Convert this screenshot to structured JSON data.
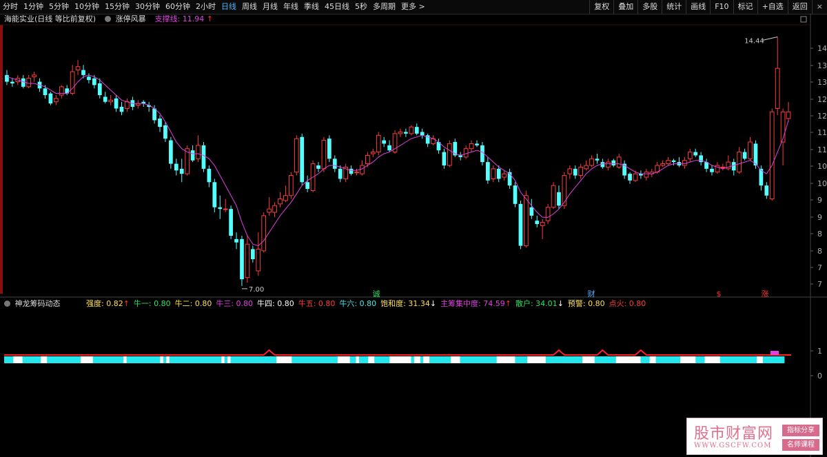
{
  "toolbar": {
    "periods": [
      "分时",
      "1分钟",
      "5分钟",
      "10分钟",
      "15分钟",
      "30分钟",
      "60分钟",
      "2小时",
      "日线",
      "周线",
      "月线",
      "年线",
      "季线",
      "45日线",
      "5秒",
      "多周期",
      "更多 >"
    ],
    "active_period": "日线",
    "actions": [
      "复权",
      "叠加",
      "多股",
      "统计",
      "画线",
      "F10",
      "标记",
      "+自选",
      "返回"
    ],
    "close_label": "×"
  },
  "main_info": {
    "stock": "海能实业(日线 等比前复权)",
    "indicator": "涨停风暴",
    "support_label": "支撑线: 11.94",
    "support_arrow": "↑"
  },
  "right_axis": {
    "price_labels": [
      "14",
      "13",
      "13",
      "12",
      "12",
      "11",
      "11",
      "10",
      "10",
      "9",
      "9",
      "8",
      "8",
      "7",
      "7"
    ],
    "sub_labels": [
      "1",
      "0"
    ]
  },
  "annotations": {
    "high_label": "14.44",
    "low_label": "7.00"
  },
  "markers": [
    "诚",
    "财",
    "$",
    "涨"
  ],
  "sub_chart": {
    "name": "神龙筹码动态",
    "items": [
      {
        "text": "强度: 0.82",
        "arrow": "↑",
        "color": "#ffe24a",
        "arrow_color": "#ff3030"
      },
      {
        "text": "牛一: 0.80",
        "arrow": "",
        "color": "#30e060",
        "arrow_color": ""
      },
      {
        "text": "牛二: 0.80",
        "arrow": "",
        "color": "#ffe24a",
        "arrow_color": ""
      },
      {
        "text": "牛三: 0.80",
        "arrow": "",
        "color": "#e040e0",
        "arrow_color": ""
      },
      {
        "text": "牛四: 0.80",
        "arrow": "",
        "color": "#ffffff",
        "arrow_color": ""
      },
      {
        "text": "牛五: 0.80",
        "arrow": "",
        "color": "#ff3b3b",
        "arrow_color": ""
      },
      {
        "text": "牛六: 0.80",
        "arrow": "",
        "color": "#4fe8e8",
        "arrow_color": ""
      },
      {
        "text": "饱和度: 31.34",
        "arrow": "↓",
        "color": "#ffe24a",
        "arrow_color": "#ffffff"
      },
      {
        "text": "主筹集中度: 74.59",
        "arrow": "↑",
        "color": "#e040e0",
        "arrow_color": "#ff3030"
      },
      {
        "text": "散户: 34.01",
        "arrow": "↓",
        "color": "#30e060",
        "arrow_color": "#ffffff"
      },
      {
        "text": "预警: 0.80",
        "arrow": "",
        "color": "#ffe24a",
        "arrow_color": ""
      },
      {
        "text": "点火: 0.80",
        "arrow": "",
        "color": "#ff3b3b",
        "arrow_color": ""
      }
    ]
  },
  "watermark": {
    "title": "股市财富网",
    "url": "WWW.GSCFW.COM",
    "tag1": "指标分享",
    "tag2": "名师课程"
  },
  "colors": {
    "up": "#ff3b3b",
    "down": "#54ffff",
    "ma": "#e040e0",
    "bar_white": "#ffffff",
    "bar_cyan": "#22e8ee",
    "red_line": "#ff2020"
  },
  "chart_data": {
    "type": "candlestick",
    "y_range": [
      6.75,
      14.8
    ],
    "candles": [
      [
        13.3,
        13.1,
        13.45,
        13.0
      ],
      [
        13.1,
        13.05,
        13.2,
        12.95
      ],
      [
        13.1,
        13.2,
        13.3,
        13.0
      ],
      [
        13.2,
        12.95,
        13.3,
        12.9
      ],
      [
        12.95,
        13.2,
        13.3,
        12.9
      ],
      [
        13.25,
        13.3,
        13.4,
        13.1
      ],
      [
        13.1,
        12.9,
        13.2,
        12.8
      ],
      [
        12.9,
        12.7,
        13.0,
        12.6
      ],
      [
        12.75,
        12.45,
        12.8,
        12.4
      ],
      [
        12.5,
        12.6,
        12.7,
        12.4
      ],
      [
        12.7,
        12.95,
        13.0,
        12.6
      ],
      [
        12.9,
        12.75,
        13.0,
        12.7
      ],
      [
        12.75,
        13.4,
        13.6,
        12.7
      ],
      [
        13.45,
        13.55,
        13.75,
        13.3
      ],
      [
        13.45,
        13.3,
        13.6,
        13.2
      ],
      [
        13.25,
        13.15,
        13.35,
        13.05
      ],
      [
        13.2,
        13.0,
        13.3,
        12.9
      ],
      [
        13.05,
        12.7,
        13.2,
        12.6
      ],
      [
        12.65,
        12.5,
        12.8,
        12.45
      ],
      [
        12.5,
        12.55,
        12.7,
        12.4
      ],
      [
        12.6,
        12.3,
        12.7,
        12.2
      ],
      [
        12.35,
        12.2,
        12.5,
        12.1
      ],
      [
        12.3,
        12.5,
        12.6,
        12.2
      ],
      [
        12.55,
        12.35,
        12.65,
        12.25
      ],
      [
        12.4,
        12.45,
        12.55,
        12.3
      ],
      [
        12.5,
        12.45,
        12.55,
        12.35
      ],
      [
        12.4,
        12.35,
        12.5,
        12.2
      ],
      [
        12.3,
        11.95,
        12.4,
        11.85
      ],
      [
        12.0,
        11.75,
        12.1,
        11.6
      ],
      [
        11.8,
        11.4,
        11.9,
        11.3
      ],
      [
        11.35,
        10.65,
        11.45,
        10.5
      ],
      [
        10.65,
        10.45,
        10.8,
        10.3
      ],
      [
        10.5,
        10.35,
        10.8,
        10.1
      ],
      [
        10.35,
        11.1,
        11.2,
        10.3
      ],
      [
        11.05,
        10.75,
        11.2,
        10.7
      ],
      [
        10.8,
        11.2,
        11.5,
        10.7
      ],
      [
        11.2,
        10.5,
        11.3,
        10.4
      ],
      [
        10.5,
        10.1,
        10.6,
        9.95
      ],
      [
        10.1,
        9.35,
        10.2,
        9.2
      ],
      [
        9.35,
        9.3,
        9.7,
        9.0
      ],
      [
        9.3,
        9.3,
        9.6,
        9.2
      ],
      [
        9.3,
        8.5,
        9.4,
        8.4
      ],
      [
        8.4,
        8.3,
        8.6,
        8.1
      ],
      [
        8.4,
        7.2,
        8.5,
        7.0
      ],
      [
        7.25,
        8.25,
        8.5,
        7.1
      ],
      [
        8.1,
        7.8,
        8.2,
        7.7
      ],
      [
        7.45,
        8.1,
        8.6,
        7.3
      ],
      [
        8.05,
        9.1,
        9.2,
        8.0
      ],
      [
        9.2,
        9.3,
        9.65,
        9.1
      ],
      [
        9.2,
        9.4,
        9.5,
        9.05
      ],
      [
        9.45,
        9.6,
        9.8,
        9.35
      ],
      [
        9.55,
        9.7,
        10.0,
        9.5
      ],
      [
        9.7,
        10.3,
        10.4,
        9.6
      ],
      [
        10.4,
        11.4,
        11.5,
        10.3
      ],
      [
        11.45,
        10.1,
        11.55,
        10.0
      ],
      [
        10.1,
        9.9,
        10.3,
        9.8
      ],
      [
        9.85,
        10.65,
        10.75,
        9.8
      ],
      [
        10.6,
        10.5,
        10.7,
        10.4
      ],
      [
        10.5,
        11.35,
        11.45,
        10.4
      ],
      [
        11.4,
        10.8,
        11.5,
        10.7
      ],
      [
        10.8,
        10.5,
        10.9,
        10.4
      ],
      [
        10.5,
        10.2,
        10.6,
        10.1
      ],
      [
        10.2,
        10.55,
        10.65,
        10.1
      ],
      [
        10.5,
        10.35,
        10.6,
        10.3
      ],
      [
        10.4,
        10.4,
        10.5,
        10.3
      ],
      [
        10.35,
        10.6,
        10.75,
        10.3
      ],
      [
        10.65,
        10.9,
        11.0,
        10.55
      ],
      [
        10.95,
        11.0,
        11.1,
        10.85
      ],
      [
        11.0,
        11.5,
        11.6,
        10.9
      ],
      [
        11.35,
        11.25,
        11.45,
        11.15
      ],
      [
        11.2,
        11.05,
        11.35,
        11.0
      ],
      [
        11.0,
        11.55,
        11.65,
        10.95
      ],
      [
        11.55,
        11.6,
        11.7,
        11.45
      ],
      [
        11.6,
        11.55,
        11.7,
        11.45
      ],
      [
        11.55,
        11.75,
        11.8,
        11.5
      ],
      [
        11.75,
        11.55,
        11.85,
        11.5
      ],
      [
        11.6,
        11.5,
        11.7,
        11.4
      ],
      [
        11.5,
        11.25,
        11.55,
        11.15
      ],
      [
        11.25,
        11.4,
        11.5,
        11.2
      ],
      [
        11.3,
        11.05,
        11.4,
        10.95
      ],
      [
        11.0,
        10.6,
        11.1,
        10.5
      ],
      [
        10.6,
        11.25,
        11.35,
        10.55
      ],
      [
        11.3,
        10.9,
        11.4,
        10.85
      ],
      [
        10.9,
        10.85,
        11.0,
        10.75
      ],
      [
        10.85,
        11.1,
        11.2,
        10.8
      ],
      [
        11.1,
        11.25,
        11.35,
        11.0
      ],
      [
        11.25,
        11.2,
        11.35,
        11.15
      ],
      [
        11.2,
        10.7,
        11.3,
        10.6
      ],
      [
        10.7,
        10.15,
        10.85,
        10.05
      ],
      [
        10.2,
        10.5,
        10.6,
        10.1
      ],
      [
        10.5,
        10.2,
        10.6,
        10.1
      ],
      [
        10.25,
        10.35,
        10.45,
        10.15
      ],
      [
        10.4,
        10.0,
        10.5,
        9.9
      ],
      [
        10.0,
        9.45,
        10.1,
        9.35
      ],
      [
        9.45,
        8.2,
        9.55,
        8.1
      ],
      [
        8.2,
        9.7,
        9.85,
        8.15
      ],
      [
        9.35,
        9.1,
        9.6,
        9.0
      ],
      [
        8.95,
        8.85,
        9.1,
        8.75
      ],
      [
        8.8,
        8.9,
        9.0,
        8.4
      ],
      [
        8.95,
        9.35,
        9.45,
        8.85
      ],
      [
        9.35,
        10.0,
        10.1,
        9.3
      ],
      [
        9.8,
        9.4,
        10.0,
        9.3
      ],
      [
        9.4,
        10.3,
        10.4,
        9.3
      ],
      [
        10.35,
        10.5,
        10.6,
        10.2
      ],
      [
        10.5,
        10.3,
        10.6,
        10.2
      ],
      [
        10.3,
        10.55,
        10.65,
        10.2
      ],
      [
        10.5,
        10.6,
        10.75,
        10.45
      ],
      [
        10.6,
        10.8,
        10.9,
        10.55
      ],
      [
        10.8,
        10.75,
        10.95,
        10.65
      ],
      [
        10.7,
        10.55,
        10.8,
        10.5
      ],
      [
        10.55,
        10.7,
        10.8,
        10.45
      ],
      [
        10.75,
        10.6,
        10.8,
        10.55
      ],
      [
        10.55,
        10.85,
        10.95,
        10.5
      ],
      [
        10.65,
        10.3,
        10.75,
        10.2
      ],
      [
        10.35,
        10.15,
        10.4,
        10.05
      ],
      [
        10.15,
        10.35,
        10.45,
        10.1
      ],
      [
        10.35,
        10.3,
        10.45,
        10.2
      ],
      [
        10.25,
        10.4,
        10.5,
        10.15
      ],
      [
        10.35,
        10.4,
        10.5,
        10.25
      ],
      [
        10.4,
        10.6,
        10.7,
        10.35
      ],
      [
        10.6,
        10.65,
        10.75,
        10.55
      ],
      [
        10.65,
        10.75,
        10.85,
        10.6
      ],
      [
        10.75,
        10.7,
        10.8,
        10.6
      ],
      [
        10.7,
        10.6,
        10.85,
        10.55
      ],
      [
        10.6,
        10.75,
        10.85,
        10.5
      ],
      [
        10.8,
        11.0,
        11.1,
        10.7
      ],
      [
        11.0,
        10.9,
        11.1,
        10.85
      ],
      [
        10.9,
        10.7,
        11.0,
        10.6
      ],
      [
        10.7,
        10.5,
        10.8,
        10.4
      ],
      [
        10.5,
        10.4,
        10.6,
        10.3
      ],
      [
        10.4,
        10.6,
        10.7,
        10.35
      ],
      [
        10.55,
        10.55,
        10.65,
        10.45
      ],
      [
        10.5,
        10.7,
        10.9,
        10.45
      ],
      [
        10.7,
        10.45,
        10.8,
        10.3
      ],
      [
        10.4,
        11.0,
        11.15,
        10.35
      ],
      [
        11.0,
        10.8,
        11.1,
        10.75
      ],
      [
        10.8,
        11.3,
        11.45,
        10.75
      ],
      [
        11.25,
        10.6,
        11.35,
        10.5
      ],
      [
        10.5,
        10.0,
        10.6,
        9.85
      ],
      [
        10.0,
        9.7,
        10.1,
        9.6
      ],
      [
        9.6,
        12.2,
        12.3,
        9.55
      ],
      [
        12.3,
        13.5,
        14.44,
        12.1
      ],
      [
        11.3,
        12.2,
        12.3,
        10.6
      ],
      [
        12.0,
        12.2,
        12.5,
        11.9
      ]
    ],
    "ma": [
      13.25,
      13.2,
      13.15,
      13.1,
      13.05,
      13.05,
      13.0,
      12.95,
      12.85,
      12.75,
      12.75,
      12.75,
      12.9,
      13.1,
      13.25,
      13.3,
      13.25,
      13.15,
      13.0,
      12.85,
      12.7,
      12.55,
      12.5,
      12.45,
      12.45,
      12.45,
      12.4,
      12.3,
      12.15,
      11.9,
      11.6,
      11.3,
      11.1,
      11.0,
      10.95,
      10.95,
      10.9,
      10.8,
      10.6,
      10.3,
      10.0,
      9.7,
      9.4,
      8.9,
      8.5,
      8.25,
      8.2,
      8.35,
      8.6,
      8.85,
      9.1,
      9.3,
      9.5,
      9.75,
      10.0,
      10.15,
      10.25,
      10.35,
      10.5,
      10.6,
      10.6,
      10.55,
      10.5,
      10.45,
      10.45,
      10.5,
      10.6,
      10.7,
      10.85,
      10.95,
      11.0,
      11.1,
      11.2,
      11.3,
      11.4,
      11.45,
      11.5,
      11.45,
      11.4,
      11.3,
      11.15,
      11.05,
      10.95,
      10.9,
      10.95,
      11.0,
      11.05,
      11.0,
      10.85,
      10.7,
      10.55,
      10.45,
      10.35,
      10.15,
      9.8,
      9.6,
      9.4,
      9.2,
      9.05,
      9.05,
      9.15,
      9.3,
      9.5,
      9.75,
      9.95,
      10.15,
      10.35,
      10.5,
      10.6,
      10.65,
      10.65,
      10.65,
      10.65,
      10.6,
      10.5,
      10.4,
      10.35,
      10.35,
      10.35,
      10.4,
      10.5,
      10.6,
      10.65,
      10.65,
      10.65,
      10.7,
      10.75,
      10.75,
      10.7,
      10.6,
      10.55,
      10.5,
      10.55,
      10.6,
      10.65,
      10.7,
      10.75,
      10.65,
      10.45,
      10.35,
      10.6,
      11.0,
      11.4,
      11.94
    ],
    "sub_bar_pattern": "CCCWWWCCCCCCWWCCCCCCCCCCCWWWWCCCCCCCCCCWCCCCCCCCCCCWCWCCCCCCCCCCCCCCCCCWCWCCCCCCCCCCCCCCCWWWWWCCCCCCCCCCCCCCCWWWWCCWCCCWWCCCCCWWWWWWWCWWCWWCCCCCCCWWWCCCCCCCCCCCCWWWWWWCCCCWWWWWWCCCCCCCCCCCCWWWWCCCCCCCWWWWWWWWCCCWWCCCCCCCCWWWWWCCCWWWWWCCCCCCCCCCCCWWCCCCCCC",
    "sub_peaks": [
      48,
      101,
      109,
      116
    ]
  }
}
